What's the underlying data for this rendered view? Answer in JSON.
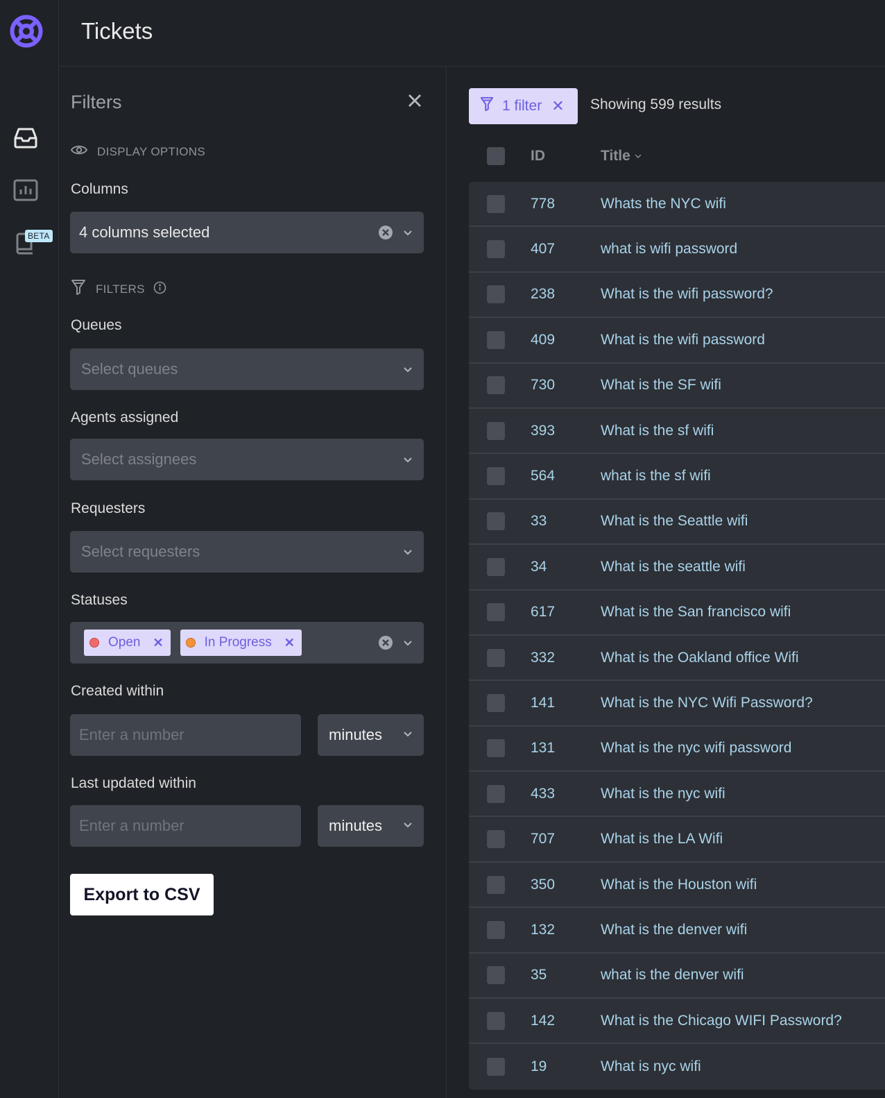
{
  "app": {
    "brand_color": "#7b61ff",
    "page_title": "Tickets"
  },
  "rail": {
    "items": [
      {
        "icon": "inbox-icon",
        "label": "Inbox",
        "active": true
      },
      {
        "icon": "analytics-icon",
        "label": "Analytics",
        "active": false
      },
      {
        "icon": "knowledge-book-icon",
        "label": "Knowledge",
        "badge": "BETA",
        "active": false
      }
    ]
  },
  "filters_panel": {
    "title": "Filters",
    "display_options": {
      "heading": "DISPLAY OPTIONS",
      "columns_label": "Columns",
      "columns_value": "4 columns selected"
    },
    "filters": {
      "heading": "FILTERS",
      "queues": {
        "label": "Queues",
        "placeholder": "Select queues"
      },
      "agents": {
        "label": "Agents assigned",
        "placeholder": "Select assignees"
      },
      "requesters": {
        "label": "Requesters",
        "placeholder": "Select requesters"
      },
      "statuses": {
        "label": "Statuses",
        "selected": [
          {
            "label": "Open",
            "color": "#f06a6a"
          },
          {
            "label": "In Progress",
            "color": "#f39236"
          }
        ]
      },
      "created_within": {
        "label": "Created within",
        "placeholder": "Enter a number",
        "unit": "minutes"
      },
      "updated_within": {
        "label": "Last updated within",
        "placeholder": "Enter a number",
        "unit": "minutes"
      }
    },
    "export_label": "Export to CSV"
  },
  "results": {
    "filter_pill": "1 filter",
    "count_text": "Showing 599 results",
    "columns": {
      "id": "ID",
      "title": "Title"
    },
    "rows": [
      {
        "id": "778",
        "title": "Whats the NYC wifi"
      },
      {
        "id": "407",
        "title": "what is wifi password"
      },
      {
        "id": "238",
        "title": "What is the wifi password?"
      },
      {
        "id": "409",
        "title": "What is the wifi password"
      },
      {
        "id": "730",
        "title": "What is the SF wifi"
      },
      {
        "id": "393",
        "title": "What is the sf wifi"
      },
      {
        "id": "564",
        "title": "what is the sf wifi"
      },
      {
        "id": "33",
        "title": "What is the Seattle wifi"
      },
      {
        "id": "34",
        "title": "What is the seattle wifi"
      },
      {
        "id": "617",
        "title": "What is the San francisco wifi"
      },
      {
        "id": "332",
        "title": "What is the Oakland office Wifi"
      },
      {
        "id": "141",
        "title": "What is the NYC Wifi Password?"
      },
      {
        "id": "131",
        "title": "What is the nyc wifi password"
      },
      {
        "id": "433",
        "title": "What is the nyc wifi"
      },
      {
        "id": "707",
        "title": "What is the LA Wifi"
      },
      {
        "id": "350",
        "title": "What is the Houston wifi"
      },
      {
        "id": "132",
        "title": "What is the denver wifi"
      },
      {
        "id": "35",
        "title": "what is the denver wifi"
      },
      {
        "id": "142",
        "title": "What is the Chicago WIFI Password?"
      },
      {
        "id": "19",
        "title": "What is nyc wifi"
      }
    ]
  }
}
